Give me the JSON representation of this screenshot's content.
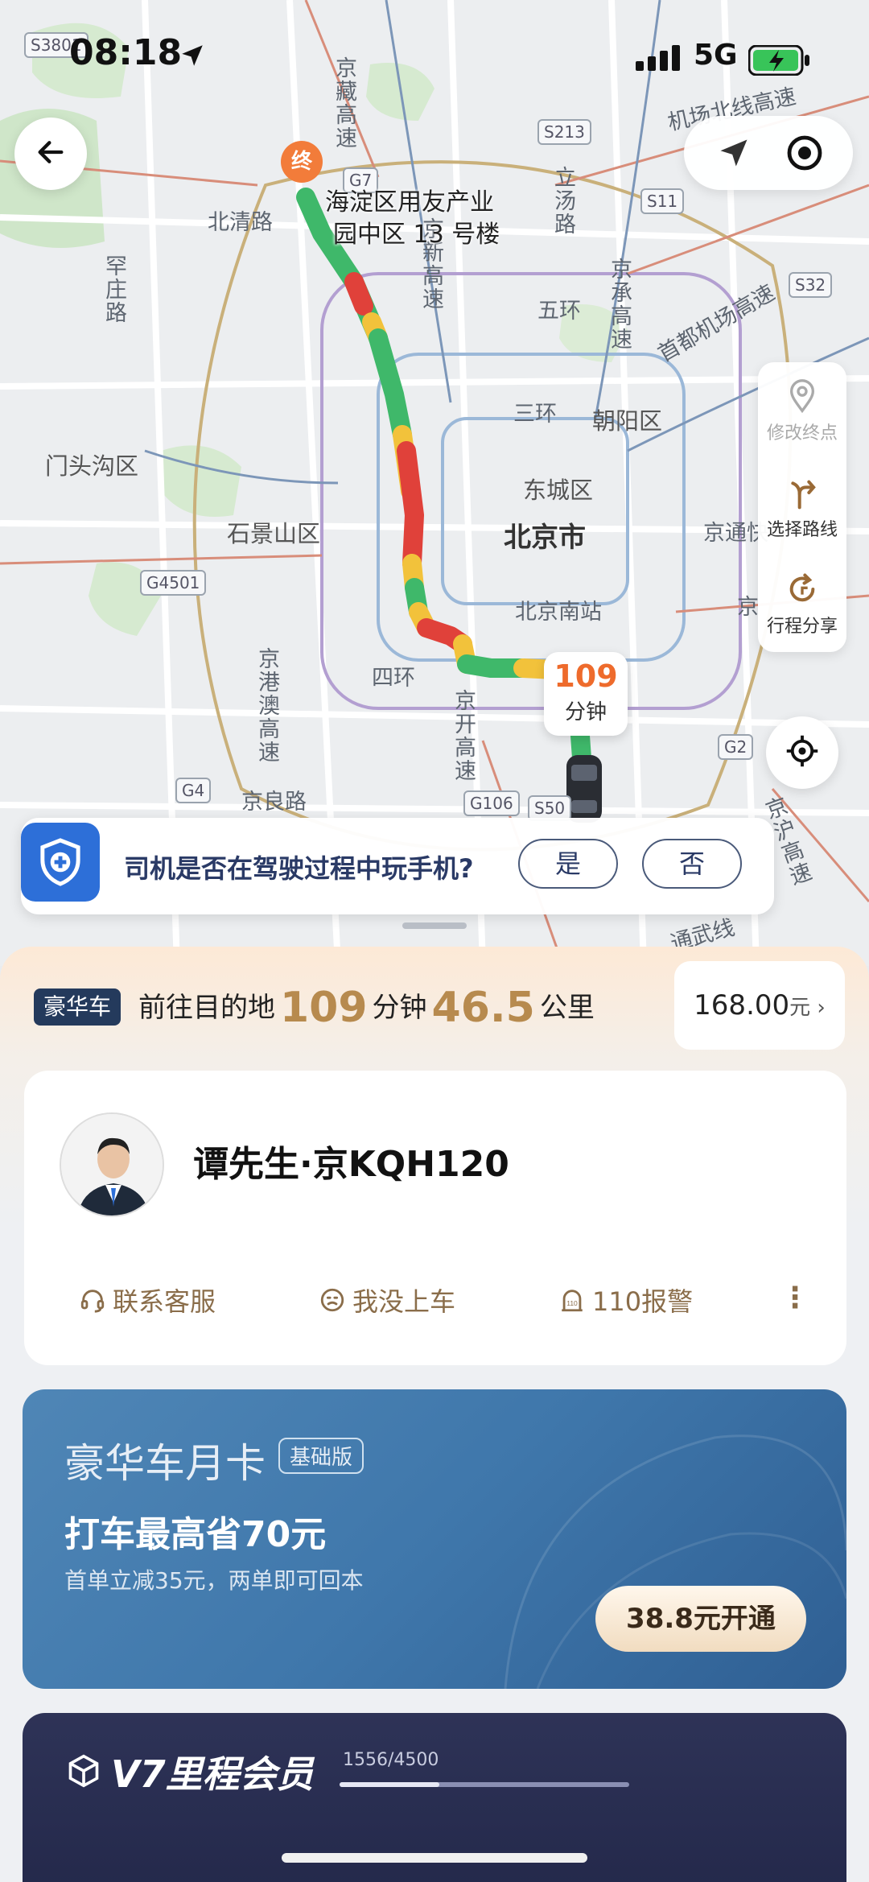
{
  "status_bar": {
    "time": "08:18",
    "network": "5G"
  },
  "map": {
    "road_badges": [
      "S3801",
      "G7",
      "S213",
      "S11",
      "S32",
      "G4501",
      "G2",
      "G4",
      "G106",
      "S50"
    ],
    "labels": {
      "beiqing_lu": "北清路",
      "mentougou": "门头沟区",
      "shijingshan": "石景山区",
      "chaoyang": "朝阳区",
      "dongcheng": "东城区",
      "beijing_shi": "北京市",
      "beijing_south": "北京南站",
      "wuhuan": "五环",
      "sanhuan": "三环",
      "sihuan": "四环",
      "jingliang_lu": "京良路",
      "jingzang": "京藏高速",
      "jinxin": "京新高速",
      "lidang": "立汤路",
      "hanzhuang": "罕庄路",
      "jingcheng": "京承高速",
      "airport_north": "机场北线高速",
      "airport": "首都机场高速",
      "jingtong": "京通快",
      "jingkai": "京开高速",
      "jinggangao": "京港澳高速",
      "tongwu": "通武线",
      "jinghu": "京沪高速",
      "jing_partial": "京"
    },
    "end_pin": "终",
    "destination": [
      "海淀区用友产业",
      "园中区 13 号楼"
    ],
    "eta": {
      "value": "109",
      "unit": "分钟"
    },
    "side_actions": [
      {
        "label": "修改终点",
        "icon": "location-pin-icon"
      },
      {
        "label": "选择路线",
        "icon": "route-fork-icon"
      },
      {
        "label": "行程分享",
        "icon": "share-loop-icon"
      }
    ]
  },
  "safety_prompt": {
    "question": "司机是否在驾驶过程中玩手机?",
    "yes": "是",
    "no": "否"
  },
  "trip": {
    "car_tag": "豪华车",
    "prefix": "前往目的地",
    "minutes": "109",
    "minutes_unit": "分钟",
    "distance": "46.5",
    "distance_unit": "公里",
    "price": "168.00",
    "price_unit": "元"
  },
  "driver": {
    "name": "谭先生·京KQH120",
    "actions": [
      {
        "label": "联系客服",
        "icon": "headset-icon"
      },
      {
        "label": "我没上车",
        "icon": "face-icon"
      },
      {
        "label": "110报警",
        "icon": "police-110-icon"
      }
    ],
    "more": "⋮"
  },
  "month_card": {
    "title": "豪华车月卡",
    "badge": "基础版",
    "headline": "打车最高省70元",
    "sub": "首单立减35元，两单即可回本",
    "button": "38.8元开通"
  },
  "vip": {
    "title": "V7里程会员",
    "progress_text": "1556/4500",
    "progress": 0.3458
  },
  "colors": {
    "route_green": "#3fb86a",
    "route_yellow": "#f2c23b",
    "route_red": "#e0413a",
    "accent_gold": "#b78a4e",
    "eta_orange": "#ee6b2c"
  }
}
